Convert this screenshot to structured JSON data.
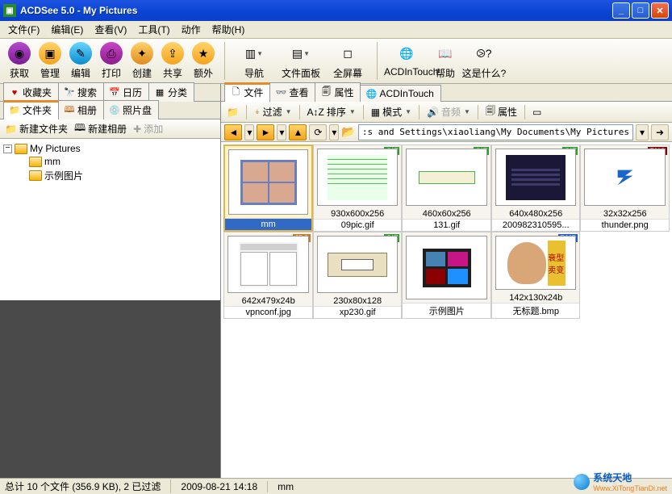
{
  "window": {
    "title": "ACDSee 5.0 - My Pictures"
  },
  "menu": {
    "file": "文件(F)",
    "edit": "编辑(E)",
    "view": "查看(V)",
    "tools": "工具(T)",
    "action": "动作",
    "help": "帮助(H)"
  },
  "toolbar": {
    "acquire": "获取",
    "manage": "管理",
    "edit": "编辑",
    "print": "打印",
    "create": "创建",
    "share": "共享",
    "extra": "额外",
    "nav": "导航",
    "filepanel": "文件面板",
    "fullscreen": "全屏幕",
    "acdintouch": "ACDInTouch",
    "help": "帮助",
    "whats": "这是什么?"
  },
  "left_tabs_top": {
    "fav": "收藏夹",
    "search": "搜索",
    "cal": "日历",
    "cat": "分类"
  },
  "left_tabs_bottom": {
    "folders": "文件夹",
    "albums": "相册",
    "discs": "照片盘"
  },
  "left_actions": {
    "newfolder": "新建文件夹",
    "newalbum": "新建相册",
    "add": "添加"
  },
  "tree": {
    "root": "My Pictures",
    "n1": "mm",
    "n2": "示例图片"
  },
  "right_tabs": {
    "files": "文件",
    "view": "查看",
    "props": "属性",
    "acd": "ACDInTouch"
  },
  "right_tools": {
    "filter": "过滤",
    "sort": "排序",
    "mode": "模式",
    "audio": "音频",
    "props": "属性"
  },
  "path": {
    "value": ":s and Settings\\xiaoliang\\My Documents\\My Pictures"
  },
  "thumbs": [
    {
      "name": "mm",
      "dims": "",
      "type": "folder",
      "selected": true
    },
    {
      "name": "09pic.gif",
      "dims": "930x600x256",
      "type": "gif"
    },
    {
      "name": "131.gif",
      "dims": "460x60x256",
      "type": "gif"
    },
    {
      "name": "200982310595...",
      "dims": "640x480x256",
      "type": "gif"
    },
    {
      "name": "thunder.png",
      "dims": "32x32x256",
      "type": "png"
    },
    {
      "name": "vpnconf.jpg",
      "dims": "642x479x24b",
      "type": "jpg"
    },
    {
      "name": "xp230.gif",
      "dims": "230x80x128",
      "type": "gif"
    },
    {
      "name": "示例图片",
      "dims": "",
      "type": "folder"
    },
    {
      "name": "无标题.bmp",
      "dims": "142x130x24b",
      "type": "bmp"
    }
  ],
  "status": {
    "count": "总计 10 个文件 (356.9 KB), 2 已过滤",
    "date": "2009-08-21 14:18",
    "sel": "mm"
  },
  "watermark": {
    "brand": "系统天地",
    "url": "Www.XiTongTianDi.net"
  },
  "baby_text": "衰型卖变"
}
